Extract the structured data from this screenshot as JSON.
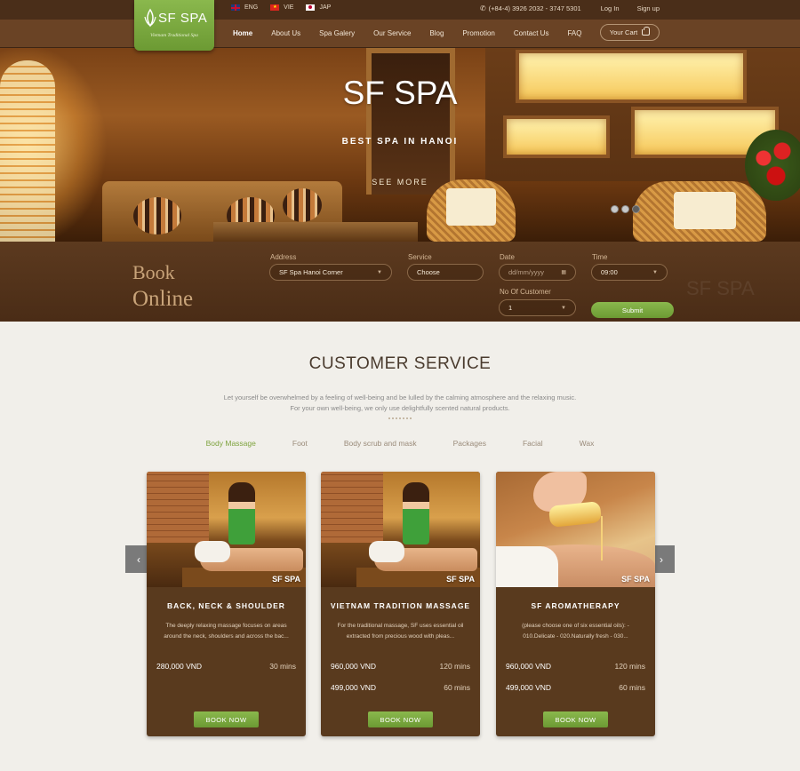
{
  "brand": {
    "name": "SF SPA",
    "tagline": "Vietnam Traditional Spa"
  },
  "languages": [
    {
      "code": "ENG",
      "flag": "uk-flag-icon"
    },
    {
      "code": "VIE",
      "flag": "vietnam-flag-icon"
    },
    {
      "code": "JAP",
      "flag": "japan-flag-icon"
    }
  ],
  "topbar": {
    "phone": "(+84-4) 3926 2032 - 3747 5301",
    "login": "Log In",
    "signup": "Sign up"
  },
  "nav": {
    "items": [
      "Home",
      "About Us",
      "Spa Galery",
      "Our Service",
      "Blog",
      "Promotion",
      "Contact Us",
      "FAQ"
    ],
    "active": "Home",
    "cart": "Your Cart"
  },
  "hero": {
    "title": "SF SPA",
    "subtitle": "BEST SPA IN HANOI",
    "cta": "SEE MORE",
    "slides": 3,
    "active_slide": 3
  },
  "booking": {
    "title_line1": "Book",
    "title_line2": "Online",
    "watermark": "SF SPA",
    "address": {
      "label": "Address",
      "value": "SF Spa Hanoi Corner"
    },
    "service": {
      "label": "Service",
      "value": "Choose"
    },
    "date": {
      "label": "Date",
      "placeholder": "dd/mm/yyyy"
    },
    "time": {
      "label": "Time",
      "value": "09:00"
    },
    "customers": {
      "label": "No Of Customer",
      "value": "1"
    },
    "submit": "Submit"
  },
  "customer_service": {
    "title": "CUSTOMER SERVICE",
    "desc_line1": "Let yourself be overwhelmed by a feeling of well-being and be lulled by the calming atmosphere and the relaxing music.",
    "desc_line2": "For your own well-being, we only use delightfully scented natural products.",
    "tabs": [
      "Body Massage",
      "Foot",
      "Body scrub and mask",
      "Packages",
      "Facial",
      "Wax"
    ],
    "active_tab": "Body Massage"
  },
  "cards": [
    {
      "title": "BACK, NECK & SHOULDER",
      "desc": "The deeply relaxing massage focuses on areas around the neck, shoulders and across the bac...",
      "prices": [
        {
          "price": "280,000 VND",
          "duration": "30 mins"
        }
      ],
      "image_logo": "SF SPA",
      "button": "BOOK NOW"
    },
    {
      "title": "VIETNAM TRADITION MASSAGE",
      "desc": "For the traditional massage, SF uses essential oil extracted from precious wood with pleas...",
      "prices": [
        {
          "price": "960,000 VND",
          "duration": "120 mins"
        },
        {
          "price": "499,000 VND",
          "duration": "60 mins"
        }
      ],
      "image_logo": "SF SPA",
      "button": "BOOK NOW"
    },
    {
      "title": "SF AROMATHERAPY",
      "desc": "(please choose one of six essential oils): - 010.Delicate - 020.Naturally fresh - 030...",
      "prices": [
        {
          "price": "960,000 VND",
          "duration": "120 mins"
        },
        {
          "price": "499,000 VND",
          "duration": "60 mins"
        }
      ],
      "image_logo": "SF SPA",
      "button": "BOOK NOW"
    }
  ],
  "arrows": {
    "left": "‹",
    "right": "›"
  }
}
